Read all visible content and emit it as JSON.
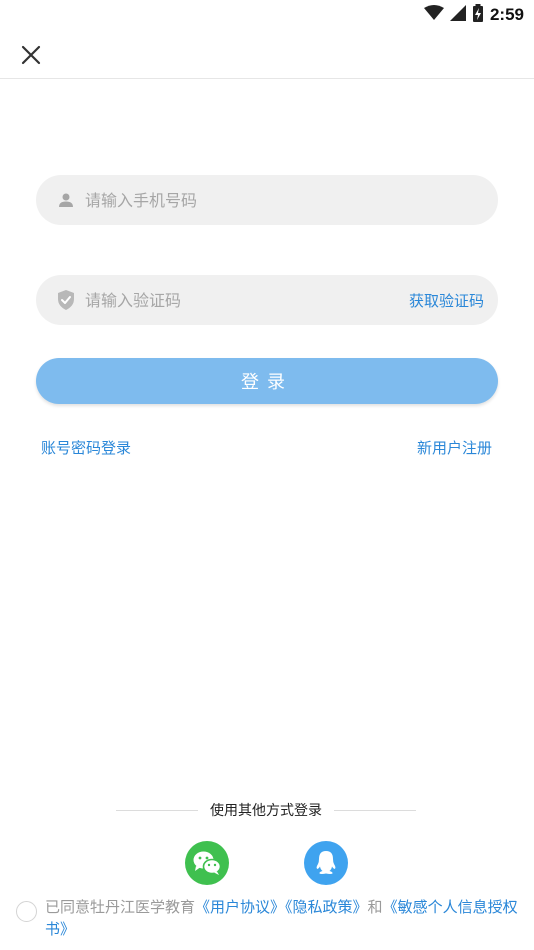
{
  "status_bar": {
    "time": "2:59"
  },
  "form": {
    "phone_placeholder": "请输入手机号码",
    "code_placeholder": "请输入验证码",
    "get_code_label": "获取验证码",
    "login_label": "登录"
  },
  "links": {
    "password_login": "账号密码登录",
    "register": "新用户注册"
  },
  "other_login": {
    "title": "使用其他方式登录",
    "providers": [
      "wechat",
      "qq"
    ]
  },
  "agreement": {
    "prefix": "已同意牡丹江医学教育",
    "user_agreement": "《用户协议》",
    "privacy_policy": "《隐私政策》",
    "connector": "和",
    "sensitive_info": "《敏感个人信息授权书》"
  },
  "colors": {
    "accent": "#2a87d8",
    "login_button": "#7ebbee",
    "wechat": "#3fc04f",
    "qq": "#3fa3ef",
    "input_bg": "#f0f0f0"
  }
}
